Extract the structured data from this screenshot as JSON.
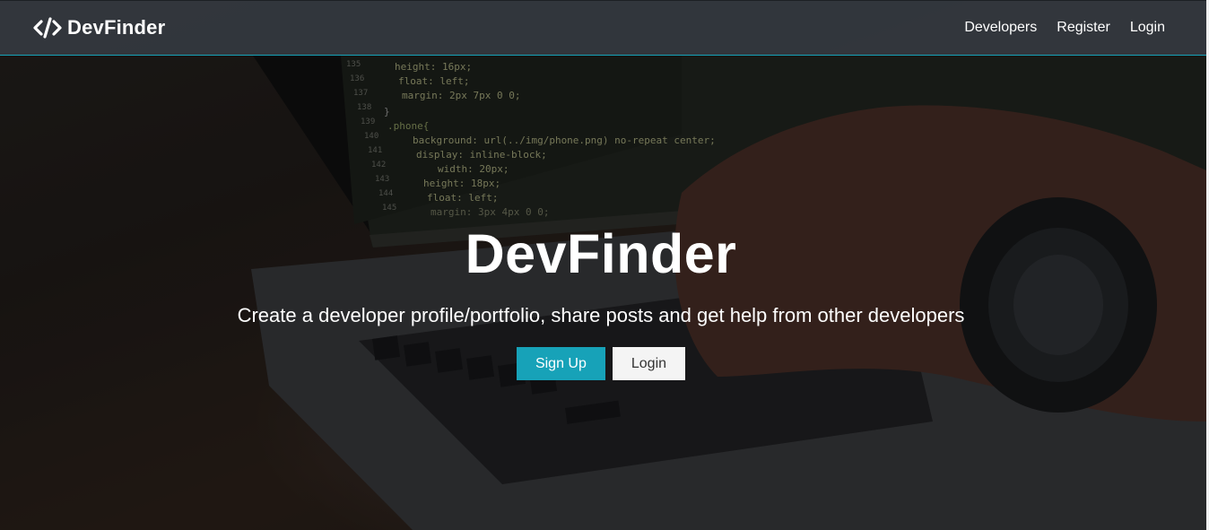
{
  "navbar": {
    "brand_icon": "code-icon",
    "brand": "DevFinder",
    "links": [
      {
        "label": "Developers"
      },
      {
        "label": "Register"
      },
      {
        "label": "Login"
      }
    ]
  },
  "landing": {
    "title": "DevFinder",
    "lead": "Create a developer profile/portfolio, share posts and get help from other developers",
    "signup_label": "Sign Up",
    "login_label": "Login"
  },
  "colors": {
    "accent": "#17a2b8",
    "navbar": "#343a40",
    "light_button": "#f4f4f4"
  }
}
